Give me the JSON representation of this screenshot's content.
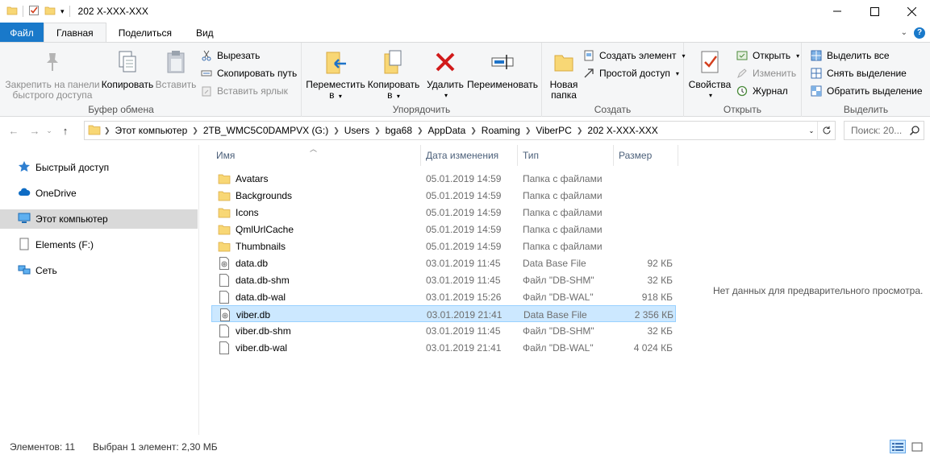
{
  "window": {
    "title": "202 X-XXX-XXX",
    "minimize_icon": "minimize-icon",
    "maximize_icon": "maximize-icon",
    "close_icon": "close-icon"
  },
  "ribbon_tabs": [
    {
      "label": "Файл"
    },
    {
      "label": "Главная"
    },
    {
      "label": "Поделиться"
    },
    {
      "label": "Вид"
    }
  ],
  "clipboard": {
    "pin_label_1": "Закрепить на панели",
    "pin_label_2": "быстрого доступа",
    "copy": "Копировать",
    "paste": "Вставить",
    "cut": "Вырезать",
    "copy_path": "Скопировать путь",
    "paste_shortcut": "Вставить ярлык",
    "group": "Буфер обмена"
  },
  "organize": {
    "move_1": "Переместить",
    "move_2": "в",
    "copy_1": "Копировать",
    "copy_2": "в",
    "delete": "Удалить",
    "rename": "Переименовать",
    "group": "Упорядочить"
  },
  "create": {
    "new_folder_1": "Новая",
    "new_folder_2": "папка",
    "new_item": "Создать элемент",
    "easy_access": "Простой доступ",
    "group": "Создать"
  },
  "open": {
    "properties": "Свойства",
    "open": "Открыть",
    "edit": "Изменить",
    "history": "Журнал",
    "group": "Открыть"
  },
  "select": {
    "select_all": "Выделить все",
    "select_none": "Снять выделение",
    "invert": "Обратить выделение",
    "group": "Выделить"
  },
  "breadcrumbs": [
    "Этот компьютер",
    "2TB_WMC5C0DAMPVX (G:)",
    "Users",
    "bga68",
    "AppData",
    "Roaming",
    "ViberPC",
    "202 X-XXX-XXX"
  ],
  "search": {
    "placeholder": "Поиск: 20..."
  },
  "nav_pane": [
    {
      "label": "Быстрый доступ",
      "icon": "star-icon"
    },
    {
      "label": "OneDrive",
      "icon": "cloud-icon"
    },
    {
      "label": "Этот компьютер",
      "icon": "computer-icon"
    },
    {
      "label": "Elements (F:)",
      "icon": "drive-icon"
    },
    {
      "label": "Сеть",
      "icon": "network-icon"
    }
  ],
  "columns": {
    "name": "Имя",
    "date": "Дата изменения",
    "type": "Тип",
    "size": "Размер"
  },
  "files": [
    {
      "name": "Avatars",
      "date": "05.01.2019 14:59",
      "type": "Папка с файлами",
      "size": "",
      "kind": "folder"
    },
    {
      "name": "Backgrounds",
      "date": "05.01.2019 14:59",
      "type": "Папка с файлами",
      "size": "",
      "kind": "folder"
    },
    {
      "name": "Icons",
      "date": "05.01.2019 14:59",
      "type": "Папка с файлами",
      "size": "",
      "kind": "folder"
    },
    {
      "name": "QmlUrlCache",
      "date": "05.01.2019 14:59",
      "type": "Папка с файлами",
      "size": "",
      "kind": "folder"
    },
    {
      "name": "Thumbnails",
      "date": "05.01.2019 14:59",
      "type": "Папка с файлами",
      "size": "",
      "kind": "folder"
    },
    {
      "name": "data.db",
      "date": "03.01.2019 11:45",
      "type": "Data Base File",
      "size": "92 КБ",
      "kind": "dbfile"
    },
    {
      "name": "data.db-shm",
      "date": "03.01.2019 11:45",
      "type": "Файл \"DB-SHM\"",
      "size": "32 КБ",
      "kind": "file"
    },
    {
      "name": "data.db-wal",
      "date": "03.01.2019 15:26",
      "type": "Файл \"DB-WAL\"",
      "size": "918 КБ",
      "kind": "file"
    },
    {
      "name": "viber.db",
      "date": "03.01.2019 21:41",
      "type": "Data Base File",
      "size": "2 356 КБ",
      "kind": "dbfile",
      "selected": true
    },
    {
      "name": "viber.db-shm",
      "date": "03.01.2019 11:45",
      "type": "Файл \"DB-SHM\"",
      "size": "32 КБ",
      "kind": "file"
    },
    {
      "name": "viber.db-wal",
      "date": "03.01.2019 21:41",
      "type": "Файл \"DB-WAL\"",
      "size": "4 024 КБ",
      "kind": "file"
    }
  ],
  "preview_text": "Нет данных для предварительного просмотра.",
  "status": {
    "count": "Элементов: 11",
    "selected": "Выбран 1 элемент: 2,30 МБ"
  }
}
